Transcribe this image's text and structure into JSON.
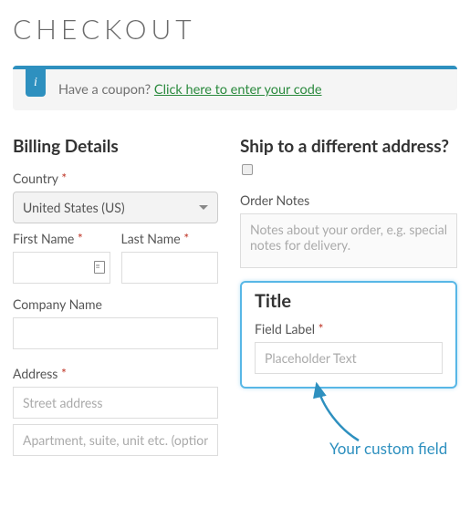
{
  "page": {
    "title": "CHECKOUT"
  },
  "notice": {
    "icon": "i",
    "text": "Have a coupon? ",
    "link": "Click here to enter your code"
  },
  "billing": {
    "heading": "Billing Details",
    "country_label": "Country",
    "country_value": "United States (US)",
    "first_name_label": "First Name",
    "last_name_label": "Last Name",
    "company_label": "Company Name",
    "address_label": "Address",
    "address_ph1": "Street address",
    "address_ph2": "Apartment, suite, unit etc. (optional)"
  },
  "ship": {
    "heading": "Ship to a different address?",
    "notes_label": "Order Notes",
    "notes_ph": "Notes about your order, e.g. special notes for delivery."
  },
  "custom": {
    "title": "Title",
    "label": "Field Label",
    "placeholder": "Placeholder Text"
  },
  "annotation": "Your custom field",
  "required_marker": "*"
}
